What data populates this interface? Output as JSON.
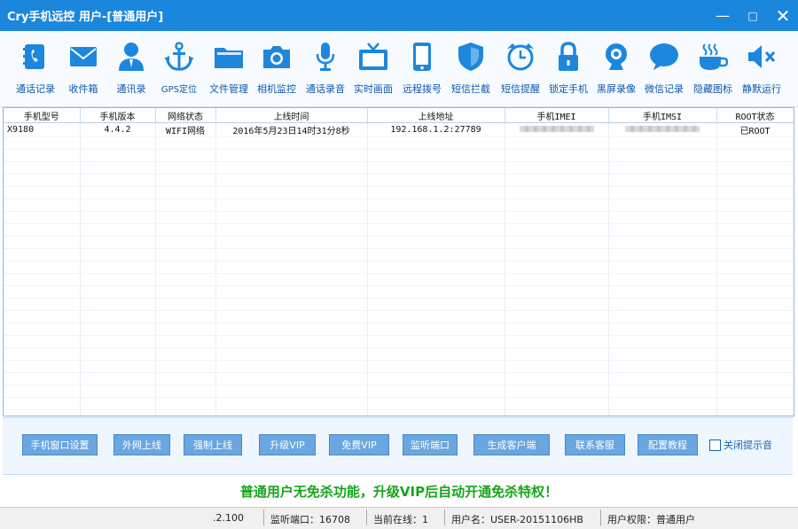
{
  "window": {
    "title": "Cry手机远控 用户-[普通用户]",
    "minimize": "—",
    "maximize": "□",
    "close": "✕"
  },
  "toolbar": [
    {
      "label": "通话记录",
      "icon": "call-log-icon"
    },
    {
      "label": "收件箱",
      "icon": "envelope-icon"
    },
    {
      "label": "通讯录",
      "icon": "contact-person-icon"
    },
    {
      "label": "GPS定位",
      "icon": "anchor-icon"
    },
    {
      "label": "文件管理",
      "icon": "folder-icon"
    },
    {
      "label": "相机监控",
      "icon": "camera-icon"
    },
    {
      "label": "通话录音",
      "icon": "microphone-icon"
    },
    {
      "label": "实时画面",
      "icon": "tv-icon"
    },
    {
      "label": "远程拨号",
      "icon": "phone-icon"
    },
    {
      "label": "短信拦截",
      "icon": "shield-icon"
    },
    {
      "label": "短信提醒",
      "icon": "alarm-clock-icon"
    },
    {
      "label": "锁定手机",
      "icon": "lock-icon"
    },
    {
      "label": "黑屏录像",
      "icon": "webcam-icon"
    },
    {
      "label": "微信记录",
      "icon": "chat-bubble-icon"
    },
    {
      "label": "隐藏图标",
      "icon": "coffee-cup-icon"
    },
    {
      "label": "静默运行",
      "icon": "speaker-mute-icon"
    }
  ],
  "table": {
    "columns": [
      "手机型号",
      "手机版本",
      "网络状态",
      "上线时间",
      "上线地址",
      "手机IMEI",
      "手机IMSI",
      "ROOT状态"
    ],
    "row": {
      "model": "X9180",
      "version": "4.4.2",
      "network": "WIFI网络",
      "online_time": "2016年5月23日14时31分8秒",
      "address": "192.168.1.2:27789",
      "root": "已ROOT"
    }
  },
  "buttons": [
    "手机窗口设置",
    "外网上线",
    "强制上线",
    "升级VIP",
    "免费VIP",
    "监听端口",
    "生成客户端",
    "联系客服",
    "配置教程"
  ],
  "checkbox_label": "关闭提示音",
  "notice": "普通用户无免杀功能，升级VIP后自动开通免杀特权！",
  "status": {
    "ip_fragment": ".2.100",
    "port": "监听端口：16708",
    "online": "当前在线：1",
    "username": "用户名：USER-20151106HB",
    "permission": "用户权限：普通用户"
  },
  "colors": {
    "titlebar": "#1a86dc",
    "icon_blue": "#1d87dd",
    "label_blue": "#0f57a9",
    "button": "#6aa6e0",
    "notice_green": "#16a51b"
  }
}
